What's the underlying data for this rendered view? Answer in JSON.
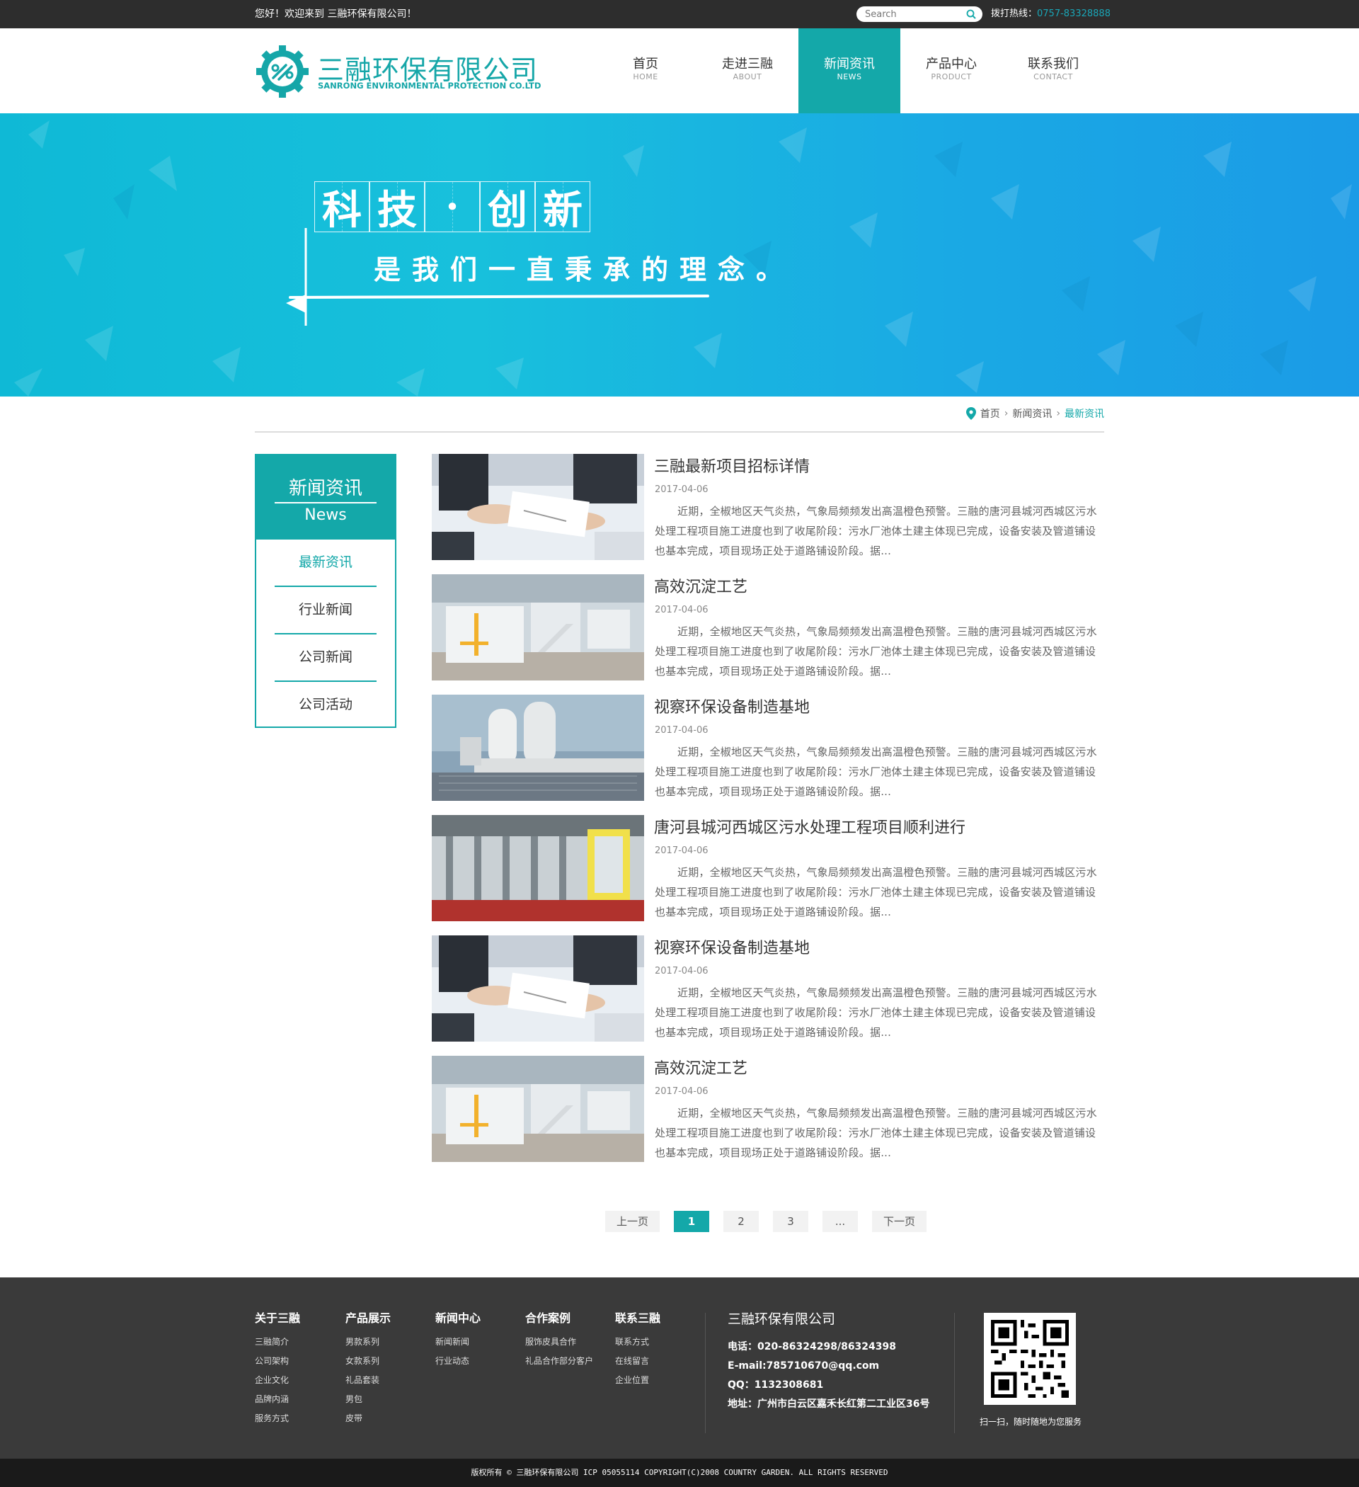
{
  "topbar": {
    "welcome": "您好！欢迎来到 三融环保有限公司！",
    "search_placeholder": "Search",
    "hotline_label": "拨打热线：",
    "hotline_number": "0757-83328888"
  },
  "header": {
    "logo_cn": "三融环保有限公司",
    "logo_en": "SANRONG ENVIRONMENTAL PROTECTION CO.LTD",
    "nav": [
      {
        "zh": "首页",
        "en": "HOME"
      },
      {
        "zh": "走进三融",
        "en": "ABOUT"
      },
      {
        "zh": "新闻资讯",
        "en": "NEWS",
        "active": true
      },
      {
        "zh": "产品中心",
        "en": "PRODUCT"
      },
      {
        "zh": "联系我们",
        "en": "CONTACT"
      }
    ]
  },
  "banner": {
    "chars": [
      "科",
      "技",
      "·",
      "创",
      "新"
    ],
    "subtitle": "是我们一直秉承的理念。"
  },
  "breadcrumb": {
    "home": "首页",
    "section": "新闻资讯",
    "current": "最新资讯"
  },
  "sidebar": {
    "title_cn": "新闻资讯",
    "title_en": "News",
    "items": [
      "最新资讯",
      "行业新闻",
      "公司新闻",
      "公司活动"
    ],
    "active": "最新资讯"
  },
  "news": [
    {
      "title": "三融最新项目招标详情",
      "date": "2017-04-06",
      "image": "meeting-photo",
      "desc": "近期，全椒地区天气炎热，气象局频频发出高温橙色预警。三融的唐河县城河西城区污水处理工程项目施工进度也到了收尾阶段：污水厂池体土建主体现已完成，设备安装及管道铺设也基本完成，项目现场正处于道路铺设阶段。据..."
    },
    {
      "title": "高效沉淀工艺",
      "date": "2017-04-06",
      "image": "factory-photo",
      "desc": "近期，全椒地区天气炎热，气象局频频发出高温橙色预警。三融的唐河县城河西城区污水处理工程项目施工进度也到了收尾阶段：污水厂池体土建主体现已完成，设备安装及管道铺设也基本完成，项目现场正处于道路铺设阶段。据..."
    },
    {
      "title": "视察环保设备制造基地",
      "date": "2017-04-06",
      "image": "tower-photo",
      "desc": "近期，全椒地区天气炎热，气象局频频发出高温橙色预警。三融的唐河县城河西城区污水处理工程项目施工进度也到了收尾阶段：污水厂池体土建主体现已完成，设备安装及管道铺设也基本完成，项目现场正处于道路铺设阶段。据..."
    },
    {
      "title": "唐河县城河西城区污水处理工程项目顺利进行",
      "date": "2017-04-06",
      "image": "pipeline-photo",
      "desc": "近期，全椒地区天气炎热，气象局频频发出高温橙色预警。三融的唐河县城河西城区污水处理工程项目施工进度也到了收尾阶段：污水厂池体土建主体现已完成，设备安装及管道铺设也基本完成，项目现场正处于道路铺设阶段。据..."
    },
    {
      "title": "视察环保设备制造基地",
      "date": "2017-04-06",
      "image": "meeting-photo",
      "desc": "近期，全椒地区天气炎热，气象局频频发出高温橙色预警。三融的唐河县城河西城区污水处理工程项目施工进度也到了收尾阶段：污水厂池体土建主体现已完成，设备安装及管道铺设也基本完成，项目现场正处于道路铺设阶段。据..."
    },
    {
      "title": "高效沉淀工艺",
      "date": "2017-04-06",
      "image": "factory-photo",
      "desc": "近期，全椒地区天气炎热，气象局频频发出高温橙色预警。三融的唐河县城河西城区污水处理工程项目施工进度也到了收尾阶段：污水厂池体土建主体现已完成，设备安装及管道铺设也基本完成，项目现场正处于道路铺设阶段。据..."
    }
  ],
  "pagination": {
    "prev": "上一页",
    "pages": [
      "1",
      "2",
      "3",
      "..."
    ],
    "current": "1",
    "next": "下一页"
  },
  "footer": {
    "columns": [
      {
        "heading": "关于三融",
        "links": [
          "三融简介",
          "公司架构",
          "企业文化",
          "品牌内涵",
          "服务方式"
        ]
      },
      {
        "heading": "产品展示",
        "links": [
          "男款系列",
          "女款系列",
          "礼品套装",
          "男包",
          "皮带"
        ]
      },
      {
        "heading": "新闻中心",
        "links": [
          "新闻新闻",
          "行业动态"
        ]
      },
      {
        "heading": "合作案例",
        "links": [
          "服饰皮具合作",
          "礼品合作部分客户"
        ]
      },
      {
        "heading": "联系三融",
        "links": [
          "联系方式",
          "在线留言",
          "企业位置"
        ]
      }
    ],
    "company": "三融环保有限公司",
    "phone": "电话：020-86324298/86324398",
    "email": "E-mail:785710670@qq.com",
    "qq": "QQ：1132308681",
    "address": "地址：广州市白云区嘉禾长红第二工业区36号",
    "qr_caption": "扫一扫，随时随地为您服务",
    "copyright": "版权所有 © 三融环保有限公司 ICP 05055114 COPYRIGHT(C)2008 COUNTRY GARDEN. ALL RIGHTS RESERVED"
  },
  "colors": {
    "accent": "#14a8a9",
    "dark": "#2d2d2d",
    "footer": "#3a3a3a",
    "banner_start": "#0fb9d6",
    "banner_end": "#1b9be6"
  }
}
